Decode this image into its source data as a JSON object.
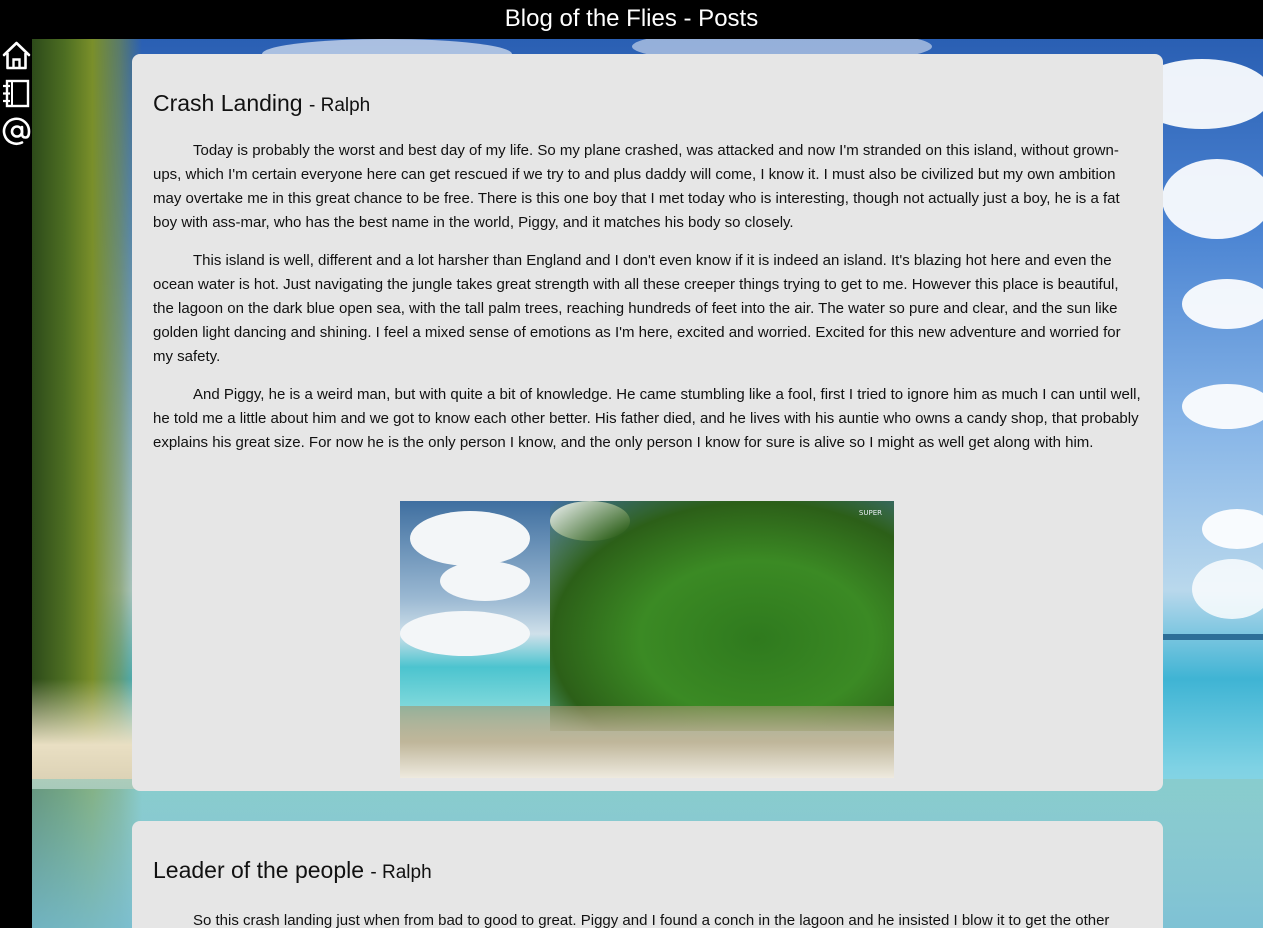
{
  "header": {
    "title": "Blog of the Flies - Posts"
  },
  "sidebar": {
    "items": [
      {
        "icon": "home-icon"
      },
      {
        "icon": "notebook-icon"
      },
      {
        "icon": "at-sign-icon"
      }
    ]
  },
  "posts": [
    {
      "title": "Crash Landing",
      "author": "- Ralph",
      "paragraphs": [
        "Today is probably the worst and best day of my life. So my plane crashed, was attacked and now I'm stranded on this island, without grown-ups, which I'm certain everyone here can get rescued if we try to and plus daddy will come, I know it. I must also be civilized but my own ambition may overtake me in this great chance to be free. There is this one boy that I met today who is interesting, though not actually just a boy, he is a fat boy with ass-mar, who has the best name in the world, Piggy, and it matches his body so closely.",
        "This island is well, different and a lot harsher than England and I don't even know if it is indeed an island. It's blazing hot here and even the ocean water is hot. Just navigating the jungle takes great strength with all these creeper things trying to get to me. However this place is beautiful, the lagoon on the dark blue open sea, with the tall palm trees, reaching hundreds of feet into the air. The water so pure and clear, and the sun like golden light dancing and shining. I feel a mixed sense of emotions as I'm here, excited and worried. Excited for this new adventure and worried for my safety.",
        "And Piggy, he is a weird man, but with quite a bit of knowledge. He came stumbling like a fool, first I tried to ignore him as much I can until well, he told me a little about him and we got to know each other better. His father died, and he lives with his auntie who owns a candy shop, that probably explains his great size. For now he is the only person I know, and the only person I know for sure is alive so I might as well get along with him."
      ],
      "image_tag": "SUPER"
    },
    {
      "title": "Leader of the people",
      "author": "- Ralph",
      "paragraphs": [
        "So this crash landing just when from bad to good to great. Piggy and I found a conch in the lagoon and he insisted I blow it to get the other"
      ]
    }
  ]
}
